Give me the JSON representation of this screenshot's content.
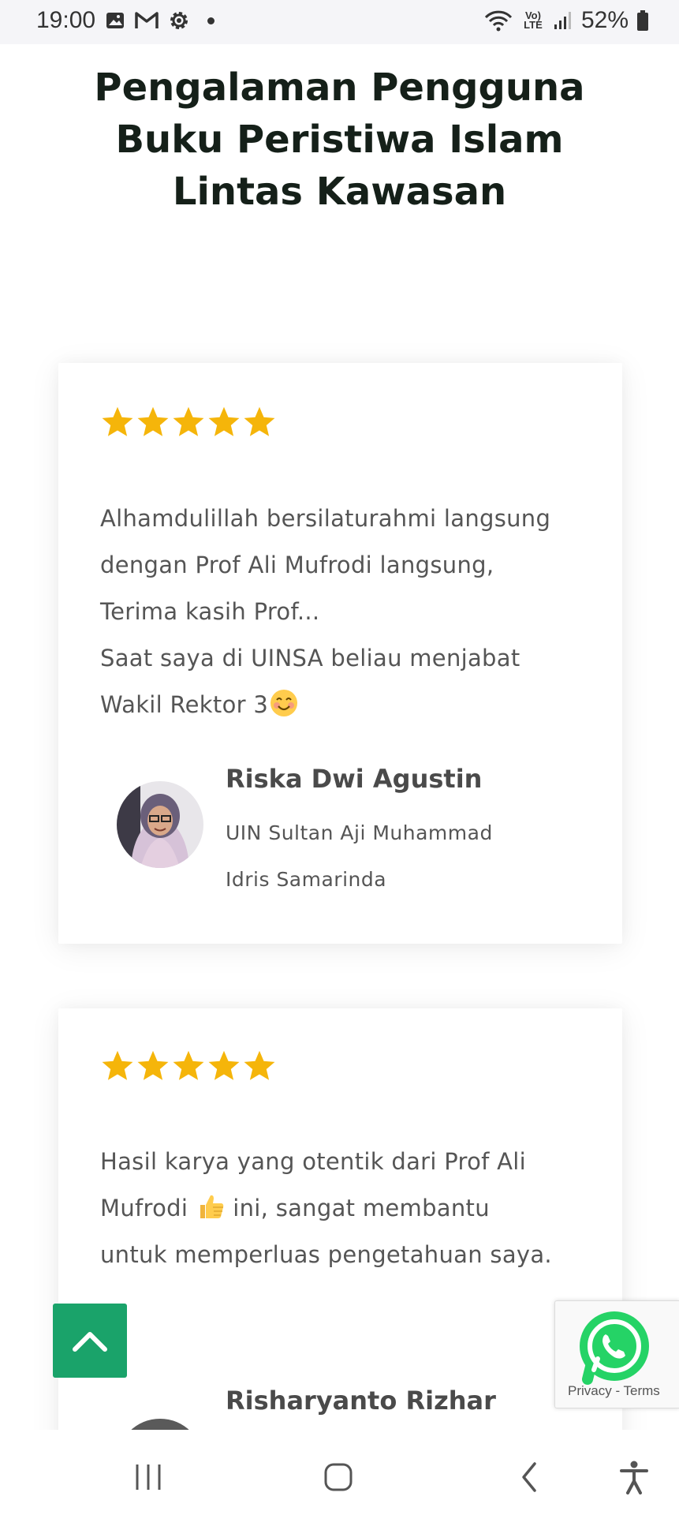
{
  "status_bar": {
    "time": "19:00",
    "battery": "52%",
    "network": "Vo) LTE"
  },
  "page": {
    "title_lines": [
      "Pengalaman Pengguna",
      "Buku Peristiwa Islam",
      "Lintas Kawasan"
    ]
  },
  "reviews": [
    {
      "rating": 5,
      "text_lines": [
        "Alhamdulillah bersilaturahmi langsung",
        "dengan Prof Ali Mufrodi langsung,",
        "Terima kasih Prof...",
        "Saat saya di UINSA beliau menjabat",
        "Wakil Rektor 3"
      ],
      "emoji": "smiling-face-emoji",
      "name": "Riska Dwi Agustin",
      "org_lines": [
        "UIN Sultan Aji Muhammad",
        "Idris Samarinda"
      ]
    },
    {
      "rating": 5,
      "text_lines": [
        "Hasil karya yang otentik dari Prof Ali",
        "Mufrodi",
        " ini, sangat membantu",
        "untuk memperluas pengetahuan saya."
      ],
      "emoji": "thumbs-up-emoji",
      "name": "Risharyanto Rizhar"
    }
  ],
  "recaptcha": {
    "links": "Privacy - Terms"
  },
  "colors": {
    "star": "#f5b50a",
    "accent_green": "#1aa36a",
    "whatsapp_green": "#25d366",
    "title": "#152019",
    "body_text": "#555555"
  },
  "icons": {
    "scroll_top": "chevron-up-icon",
    "whatsapp": "whatsapp-icon",
    "nav": [
      "recent-apps-icon",
      "home-icon",
      "back-icon",
      "accessibility-icon"
    ]
  }
}
